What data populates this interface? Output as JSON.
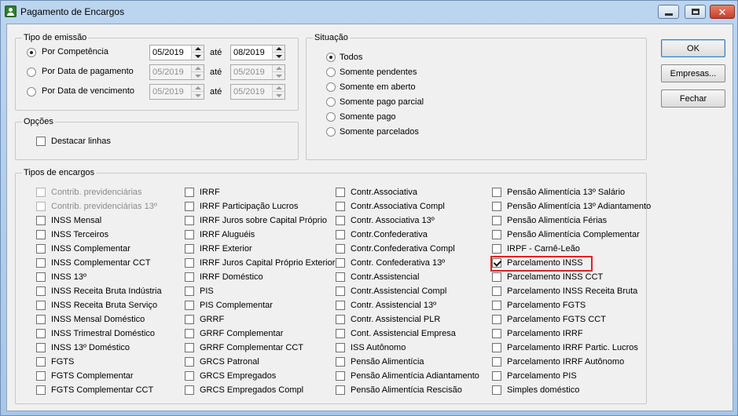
{
  "window": {
    "title": "Pagamento de Encargos",
    "controls": {
      "minimize": "—",
      "maximize": "□",
      "close": "✕"
    }
  },
  "tipo_emissao": {
    "legend": "Tipo de emissão",
    "ate_label": "até",
    "rows": [
      {
        "label": "Por Competência",
        "selected": true,
        "from": "05/2019",
        "to": "08/2019",
        "enabled": true
      },
      {
        "label": "Por Data de pagamento",
        "selected": false,
        "from": "05/2019",
        "to": "05/2019",
        "enabled": false
      },
      {
        "label": "Por Data de vencimento",
        "selected": false,
        "from": "05/2019",
        "to": "05/2019",
        "enabled": false
      }
    ]
  },
  "opcoes": {
    "legend": "Opções",
    "destacar_linhas": {
      "label": "Destacar linhas",
      "checked": false
    }
  },
  "situacao": {
    "legend": "Situação",
    "options": [
      {
        "label": "Todos",
        "selected": true
      },
      {
        "label": "Somente pendentes",
        "selected": false
      },
      {
        "label": "Somente em aberto",
        "selected": false
      },
      {
        "label": "Somente pago parcial",
        "selected": false
      },
      {
        "label": "Somente pago",
        "selected": false
      },
      {
        "label": "Somente parcelados",
        "selected": false
      }
    ]
  },
  "buttons": {
    "ok": "OK",
    "empresas": "Empresas...",
    "fechar": "Fechar"
  },
  "tipos_encargos": {
    "legend": "Tipos de encargos",
    "highlight_color": "#e02020",
    "columns": [
      [
        "Contrib. previdenciárias",
        "Contrib. previdenciárias 13º",
        "INSS Mensal",
        "INSS Terceiros",
        "INSS Complementar",
        "INSS Complementar CCT",
        "INSS 13º",
        "INSS Receita Bruta Indústria",
        "INSS Receita Bruta Serviço",
        "INSS Mensal Doméstico",
        "INSS Trimestral Doméstico",
        "INSS 13º Doméstico",
        "FGTS",
        "FGTS Complementar",
        "FGTS Complementar CCT"
      ],
      [
        "IRRF",
        "IRRF Participação Lucros",
        "IRRF Juros sobre Capital Próprio",
        "IRRF Aluguéis",
        "IRRF Exterior",
        "IRRF Juros Capital Próprio Exterior",
        "IRRF Doméstico",
        "PIS",
        "PIS Complementar",
        "GRRF",
        "GRRF Complementar",
        "GRRF Complementar CCT",
        "GRCS Patronal",
        "GRCS Empregados",
        "GRCS Empregados Compl"
      ],
      [
        "Contr.Associativa",
        "Contr.Associativa Compl",
        "Contr. Associativa 13º",
        "Contr.Confederativa",
        "Contr.Confederativa Compl",
        "Contr. Confederativa 13º",
        "Contr.Assistencial",
        "Contr.Assistencial Compl",
        "Contr. Assistencial 13º",
        "Contr. Assistencial PLR",
        "Cont. Assistencial Empresa",
        "ISS Autônomo",
        "Pensão Alimentícia",
        "Pensão Alimentícia Adiantamento",
        "Pensão Alimentícia Rescisão"
      ],
      [
        "Pensão Alimentícia 13º Salário",
        "Pensão Alimentícia 13º Adiantamento",
        "Pensão Alimentícia Férias",
        "Pensão Alimentícia Complementar",
        "IRPF - Carnê-Leão",
        "Parcelamento INSS",
        "Parcelamento INSS CCT",
        "Parcelamento INSS Receita Bruta",
        "Parcelamento FGTS",
        "Parcelamento FGTS CCT",
        "Parcelamento IRRF",
        "Parcelamento IRRF Partic. Lucros",
        "Parcelamento IRRF Autônomo",
        "Parcelamento PIS",
        "Simples doméstico"
      ]
    ],
    "checked": [
      "Parcelamento INSS"
    ],
    "disabled": [
      "Contrib. previdenciárias",
      "Contrib. previdenciárias 13º"
    ],
    "highlighted": "Parcelamento INSS"
  }
}
